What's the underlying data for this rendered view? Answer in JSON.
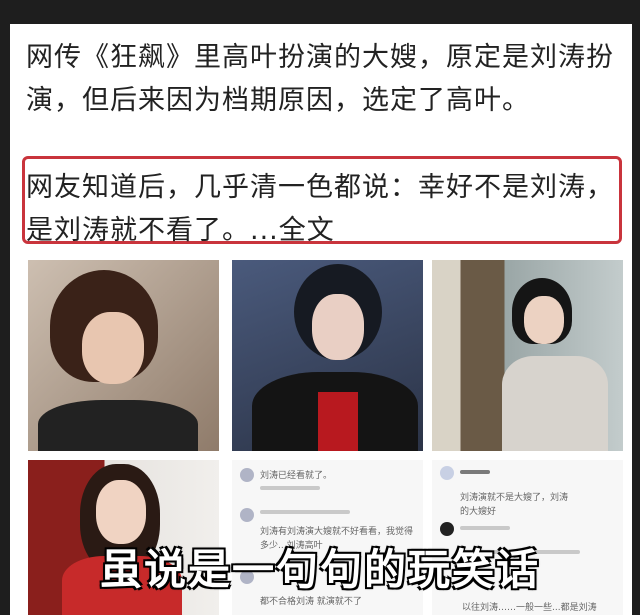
{
  "post": {
    "paragraph": "网传《狂飙》里高叶扮演的大嫂，原定是刘涛扮演，但后来因为档期原因，选定了高叶。",
    "highlight": "网友知道后，几乎清一色都说：幸好不是刘涛，是刘涛就不看了。...全文"
  },
  "tiles": {
    "chat1": {
      "top_line": "刘涛已经看就了。",
      "line2": "刘涛有刘涛演大嫂就不好看看，我觉得",
      "line3": "多少...刘涛高叶",
      "line4": "都不合格刘涛 就演就不了"
    },
    "chat2": {
      "line1": "刘涛演就不是大嫂了，刘涛",
      "line2": "的大嫂好",
      "footer": "以往刘涛……一般一些...都是刘涛"
    }
  },
  "overlay": {
    "caption": "虽说是一句句的玩笑话"
  },
  "colors": {
    "highlight_border": "#c9343c",
    "caption_text": "#ffffff"
  }
}
